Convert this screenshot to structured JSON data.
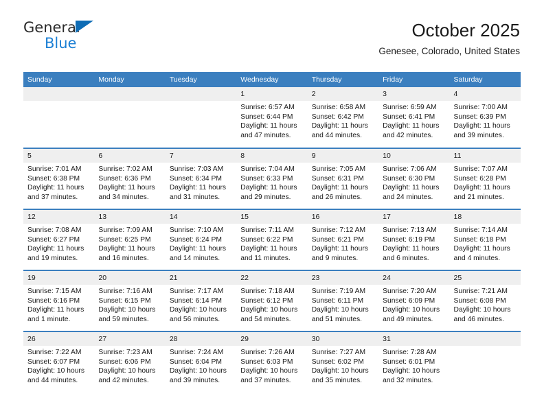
{
  "brand": {
    "name_top": "General",
    "name_bottom": "Blue",
    "triangle_icon": "triangle-icon",
    "color_dark": "#2b2b2b",
    "color_blue": "#1b7fd4"
  },
  "header": {
    "title": "October 2025",
    "subtitle": "Genesee, Colorado, United States"
  },
  "theme": {
    "header_row_bg": "#3b7fbf",
    "header_row_text": "#ffffff",
    "daynum_bg": "#efefef",
    "row_divider": "#3b7fbf"
  },
  "weekdays": [
    "Sunday",
    "Monday",
    "Tuesday",
    "Wednesday",
    "Thursday",
    "Friday",
    "Saturday"
  ],
  "labels": {
    "sunrise_prefix": "Sunrise:",
    "sunset_prefix": "Sunset:",
    "daylight_prefix": "Daylight:"
  },
  "weeks": [
    [
      {
        "day": "",
        "empty": true
      },
      {
        "day": "",
        "empty": true
      },
      {
        "day": "",
        "empty": true
      },
      {
        "day": "1",
        "sunrise": "Sunrise: 6:57 AM",
        "sunset": "Sunset: 6:44 PM",
        "daylight_l1": "Daylight: 11 hours",
        "daylight_l2": "and 47 minutes."
      },
      {
        "day": "2",
        "sunrise": "Sunrise: 6:58 AM",
        "sunset": "Sunset: 6:42 PM",
        "daylight_l1": "Daylight: 11 hours",
        "daylight_l2": "and 44 minutes."
      },
      {
        "day": "3",
        "sunrise": "Sunrise: 6:59 AM",
        "sunset": "Sunset: 6:41 PM",
        "daylight_l1": "Daylight: 11 hours",
        "daylight_l2": "and 42 minutes."
      },
      {
        "day": "4",
        "sunrise": "Sunrise: 7:00 AM",
        "sunset": "Sunset: 6:39 PM",
        "daylight_l1": "Daylight: 11 hours",
        "daylight_l2": "and 39 minutes."
      }
    ],
    [
      {
        "day": "5",
        "sunrise": "Sunrise: 7:01 AM",
        "sunset": "Sunset: 6:38 PM",
        "daylight_l1": "Daylight: 11 hours",
        "daylight_l2": "and 37 minutes."
      },
      {
        "day": "6",
        "sunrise": "Sunrise: 7:02 AM",
        "sunset": "Sunset: 6:36 PM",
        "daylight_l1": "Daylight: 11 hours",
        "daylight_l2": "and 34 minutes."
      },
      {
        "day": "7",
        "sunrise": "Sunrise: 7:03 AM",
        "sunset": "Sunset: 6:34 PM",
        "daylight_l1": "Daylight: 11 hours",
        "daylight_l2": "and 31 minutes."
      },
      {
        "day": "8",
        "sunrise": "Sunrise: 7:04 AM",
        "sunset": "Sunset: 6:33 PM",
        "daylight_l1": "Daylight: 11 hours",
        "daylight_l2": "and 29 minutes."
      },
      {
        "day": "9",
        "sunrise": "Sunrise: 7:05 AM",
        "sunset": "Sunset: 6:31 PM",
        "daylight_l1": "Daylight: 11 hours",
        "daylight_l2": "and 26 minutes."
      },
      {
        "day": "10",
        "sunrise": "Sunrise: 7:06 AM",
        "sunset": "Sunset: 6:30 PM",
        "daylight_l1": "Daylight: 11 hours",
        "daylight_l2": "and 24 minutes."
      },
      {
        "day": "11",
        "sunrise": "Sunrise: 7:07 AM",
        "sunset": "Sunset: 6:28 PM",
        "daylight_l1": "Daylight: 11 hours",
        "daylight_l2": "and 21 minutes."
      }
    ],
    [
      {
        "day": "12",
        "sunrise": "Sunrise: 7:08 AM",
        "sunset": "Sunset: 6:27 PM",
        "daylight_l1": "Daylight: 11 hours",
        "daylight_l2": "and 19 minutes."
      },
      {
        "day": "13",
        "sunrise": "Sunrise: 7:09 AM",
        "sunset": "Sunset: 6:25 PM",
        "daylight_l1": "Daylight: 11 hours",
        "daylight_l2": "and 16 minutes."
      },
      {
        "day": "14",
        "sunrise": "Sunrise: 7:10 AM",
        "sunset": "Sunset: 6:24 PM",
        "daylight_l1": "Daylight: 11 hours",
        "daylight_l2": "and 14 minutes."
      },
      {
        "day": "15",
        "sunrise": "Sunrise: 7:11 AM",
        "sunset": "Sunset: 6:22 PM",
        "daylight_l1": "Daylight: 11 hours",
        "daylight_l2": "and 11 minutes."
      },
      {
        "day": "16",
        "sunrise": "Sunrise: 7:12 AM",
        "sunset": "Sunset: 6:21 PM",
        "daylight_l1": "Daylight: 11 hours",
        "daylight_l2": "and 9 minutes."
      },
      {
        "day": "17",
        "sunrise": "Sunrise: 7:13 AM",
        "sunset": "Sunset: 6:19 PM",
        "daylight_l1": "Daylight: 11 hours",
        "daylight_l2": "and 6 minutes."
      },
      {
        "day": "18",
        "sunrise": "Sunrise: 7:14 AM",
        "sunset": "Sunset: 6:18 PM",
        "daylight_l1": "Daylight: 11 hours",
        "daylight_l2": "and 4 minutes."
      }
    ],
    [
      {
        "day": "19",
        "sunrise": "Sunrise: 7:15 AM",
        "sunset": "Sunset: 6:16 PM",
        "daylight_l1": "Daylight: 11 hours",
        "daylight_l2": "and 1 minute."
      },
      {
        "day": "20",
        "sunrise": "Sunrise: 7:16 AM",
        "sunset": "Sunset: 6:15 PM",
        "daylight_l1": "Daylight: 10 hours",
        "daylight_l2": "and 59 minutes."
      },
      {
        "day": "21",
        "sunrise": "Sunrise: 7:17 AM",
        "sunset": "Sunset: 6:14 PM",
        "daylight_l1": "Daylight: 10 hours",
        "daylight_l2": "and 56 minutes."
      },
      {
        "day": "22",
        "sunrise": "Sunrise: 7:18 AM",
        "sunset": "Sunset: 6:12 PM",
        "daylight_l1": "Daylight: 10 hours",
        "daylight_l2": "and 54 minutes."
      },
      {
        "day": "23",
        "sunrise": "Sunrise: 7:19 AM",
        "sunset": "Sunset: 6:11 PM",
        "daylight_l1": "Daylight: 10 hours",
        "daylight_l2": "and 51 minutes."
      },
      {
        "day": "24",
        "sunrise": "Sunrise: 7:20 AM",
        "sunset": "Sunset: 6:09 PM",
        "daylight_l1": "Daylight: 10 hours",
        "daylight_l2": "and 49 minutes."
      },
      {
        "day": "25",
        "sunrise": "Sunrise: 7:21 AM",
        "sunset": "Sunset: 6:08 PM",
        "daylight_l1": "Daylight: 10 hours",
        "daylight_l2": "and 46 minutes."
      }
    ],
    [
      {
        "day": "26",
        "sunrise": "Sunrise: 7:22 AM",
        "sunset": "Sunset: 6:07 PM",
        "daylight_l1": "Daylight: 10 hours",
        "daylight_l2": "and 44 minutes."
      },
      {
        "day": "27",
        "sunrise": "Sunrise: 7:23 AM",
        "sunset": "Sunset: 6:06 PM",
        "daylight_l1": "Daylight: 10 hours",
        "daylight_l2": "and 42 minutes."
      },
      {
        "day": "28",
        "sunrise": "Sunrise: 7:24 AM",
        "sunset": "Sunset: 6:04 PM",
        "daylight_l1": "Daylight: 10 hours",
        "daylight_l2": "and 39 minutes."
      },
      {
        "day": "29",
        "sunrise": "Sunrise: 7:26 AM",
        "sunset": "Sunset: 6:03 PM",
        "daylight_l1": "Daylight: 10 hours",
        "daylight_l2": "and 37 minutes."
      },
      {
        "day": "30",
        "sunrise": "Sunrise: 7:27 AM",
        "sunset": "Sunset: 6:02 PM",
        "daylight_l1": "Daylight: 10 hours",
        "daylight_l2": "and 35 minutes."
      },
      {
        "day": "31",
        "sunrise": "Sunrise: 7:28 AM",
        "sunset": "Sunset: 6:01 PM",
        "daylight_l1": "Daylight: 10 hours",
        "daylight_l2": "and 32 minutes."
      },
      {
        "day": "",
        "empty": true
      }
    ]
  ]
}
